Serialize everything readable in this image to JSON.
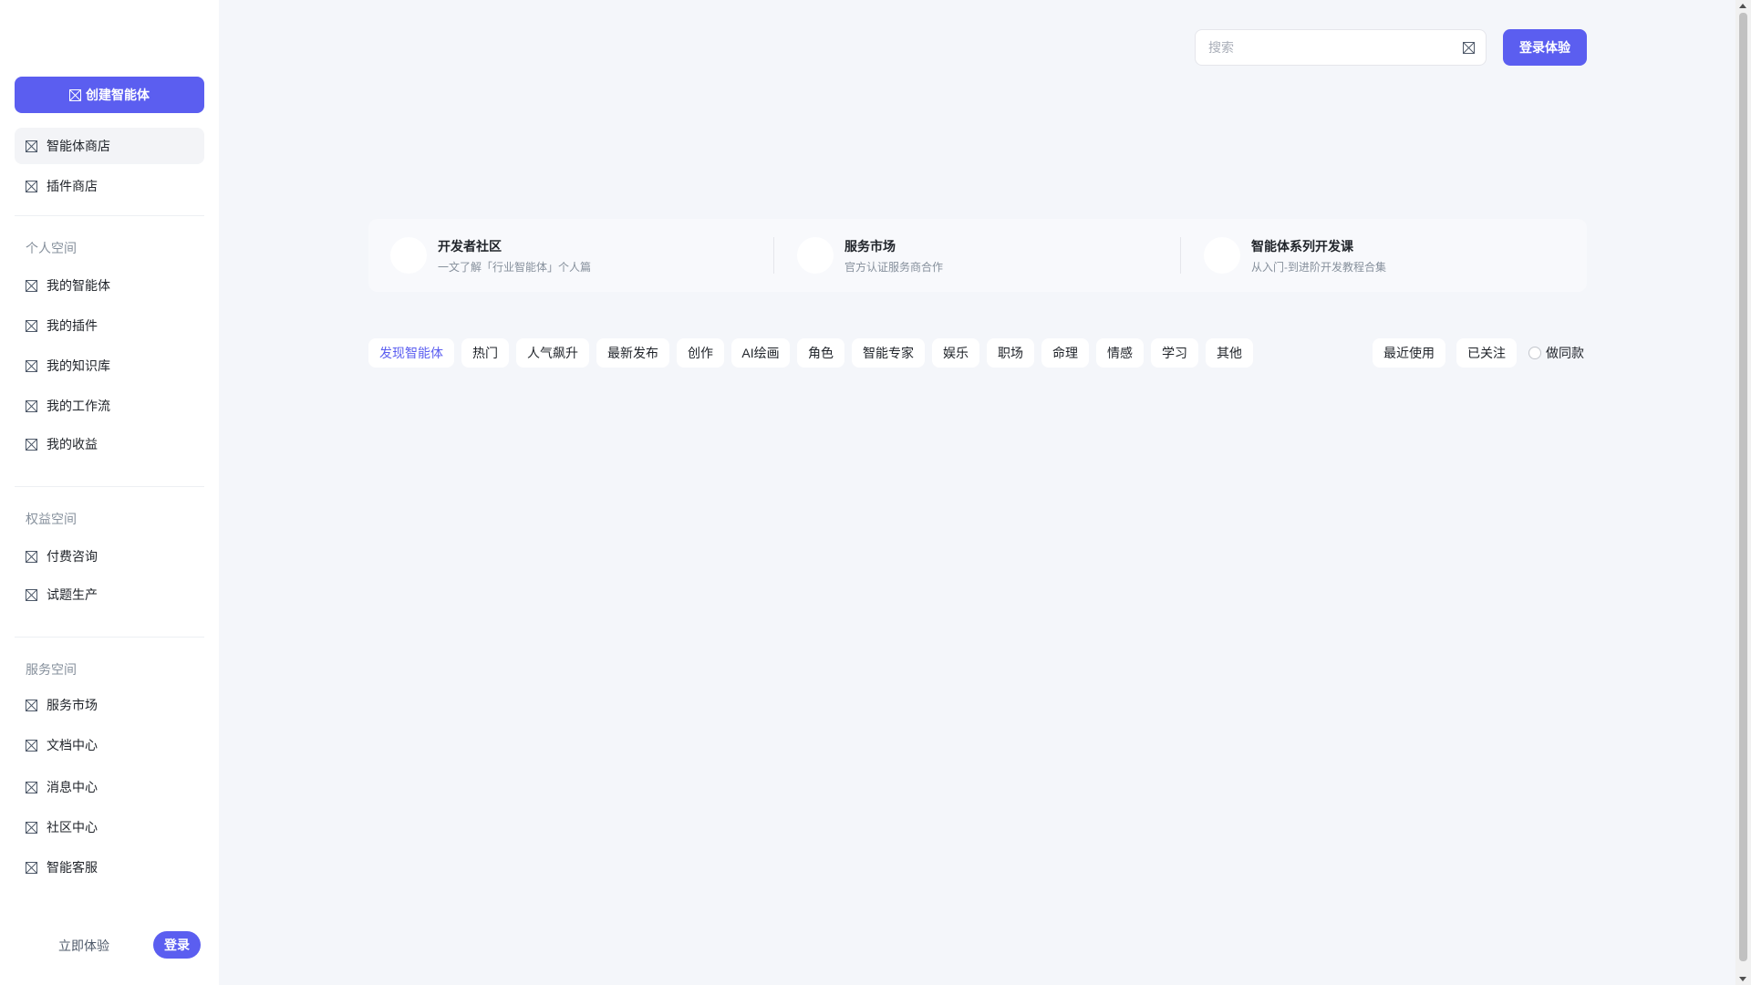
{
  "sidebar": {
    "create_button": {
      "label": "创建智能体",
      "icon": "image-placeholder-icon"
    },
    "top_items": [
      {
        "label": "智能体商店",
        "icon": "image-placeholder-icon"
      },
      {
        "label": "插件商店",
        "icon": "image-placeholder-icon"
      }
    ],
    "sections": [
      {
        "title": "个人空间",
        "items": [
          {
            "label": "我的智能体"
          },
          {
            "label": "我的插件"
          },
          {
            "label": "我的知识库"
          },
          {
            "label": "我的工作流"
          },
          {
            "label": "我的收益"
          }
        ]
      },
      {
        "title": "权益空间",
        "items": [
          {
            "label": "付费咨询"
          },
          {
            "label": "试题生产"
          }
        ]
      },
      {
        "title": "服务空间",
        "items": [
          {
            "label": "服务市场"
          },
          {
            "label": "文档中心"
          },
          {
            "label": "消息中心"
          },
          {
            "label": "社区中心"
          },
          {
            "label": "智能客服"
          }
        ]
      }
    ],
    "footer": {
      "try_label": "立即体验",
      "login_label": "登录"
    }
  },
  "header": {
    "search": {
      "placeholder": "搜索",
      "value": ""
    },
    "login_button": "登录体验"
  },
  "banner": [
    {
      "title": "开发者社区",
      "subtitle": "一文了解「行业智能体」个人篇"
    },
    {
      "title": "服务市场",
      "subtitle": "官方认证服务商合作"
    },
    {
      "title": "智能体系列开发课",
      "subtitle": "从入门-到进阶开发教程合集"
    }
  ],
  "tabs": [
    {
      "label": "发现智能体",
      "active": true
    },
    {
      "label": "热门"
    },
    {
      "label": "人气飙升"
    },
    {
      "label": "最新发布"
    },
    {
      "label": "创作"
    },
    {
      "label": "AI绘画"
    },
    {
      "label": "角色"
    },
    {
      "label": "智能专家"
    },
    {
      "label": "娱乐"
    },
    {
      "label": "职场"
    },
    {
      "label": "命理"
    },
    {
      "label": "情感"
    },
    {
      "label": "学习"
    },
    {
      "label": "其他"
    }
  ],
  "filters": {
    "recent": "最近使用",
    "followed": "已关注",
    "same_style": "做同款"
  },
  "colors": {
    "accent": "#5b5ef0",
    "background": "#f4f6fa"
  }
}
